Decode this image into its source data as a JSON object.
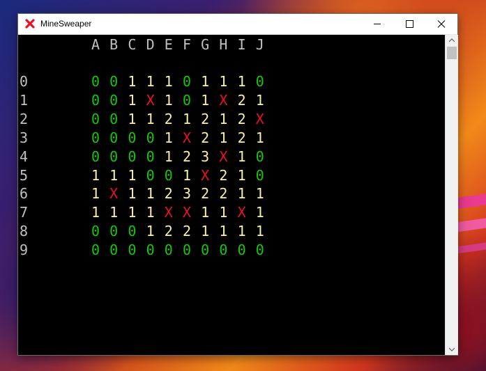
{
  "window": {
    "title": "MineSweaper",
    "accent_color": "#e81123"
  },
  "board": {
    "columns": [
      "A",
      "B",
      "C",
      "D",
      "E",
      "F",
      "G",
      "H",
      "I",
      "J"
    ],
    "rows": [
      "0",
      "1",
      "2",
      "3",
      "4",
      "5",
      "6",
      "7",
      "8",
      "9"
    ],
    "cells": [
      [
        "0",
        "0",
        "1",
        "1",
        "1",
        "0",
        "1",
        "1",
        "1",
        "0"
      ],
      [
        "0",
        "0",
        "1",
        "X",
        "1",
        "0",
        "1",
        "X",
        "2",
        "1"
      ],
      [
        "0",
        "0",
        "1",
        "1",
        "2",
        "1",
        "2",
        "1",
        "2",
        "X"
      ],
      [
        "0",
        "0",
        "0",
        "0",
        "1",
        "X",
        "2",
        "1",
        "2",
        "1"
      ],
      [
        "0",
        "0",
        "0",
        "0",
        "1",
        "2",
        "3",
        "X",
        "1",
        "0"
      ],
      [
        "1",
        "1",
        "1",
        "0",
        "0",
        "1",
        "X",
        "2",
        "1",
        "0"
      ],
      [
        "1",
        "X",
        "1",
        "1",
        "2",
        "3",
        "2",
        "2",
        "1",
        "1"
      ],
      [
        "1",
        "1",
        "1",
        "1",
        "X",
        "X",
        "1",
        "1",
        "X",
        "1"
      ],
      [
        "0",
        "0",
        "0",
        "1",
        "2",
        "2",
        "1",
        "1",
        "1",
        "1"
      ],
      [
        "0",
        "0",
        "0",
        "0",
        "0",
        "0",
        "0",
        "0",
        "0",
        "0"
      ]
    ],
    "colors": {
      "zero": "#16c60c",
      "number": "#f9f1a5",
      "mine": "#e81123",
      "header": "#c0c0c0"
    }
  }
}
